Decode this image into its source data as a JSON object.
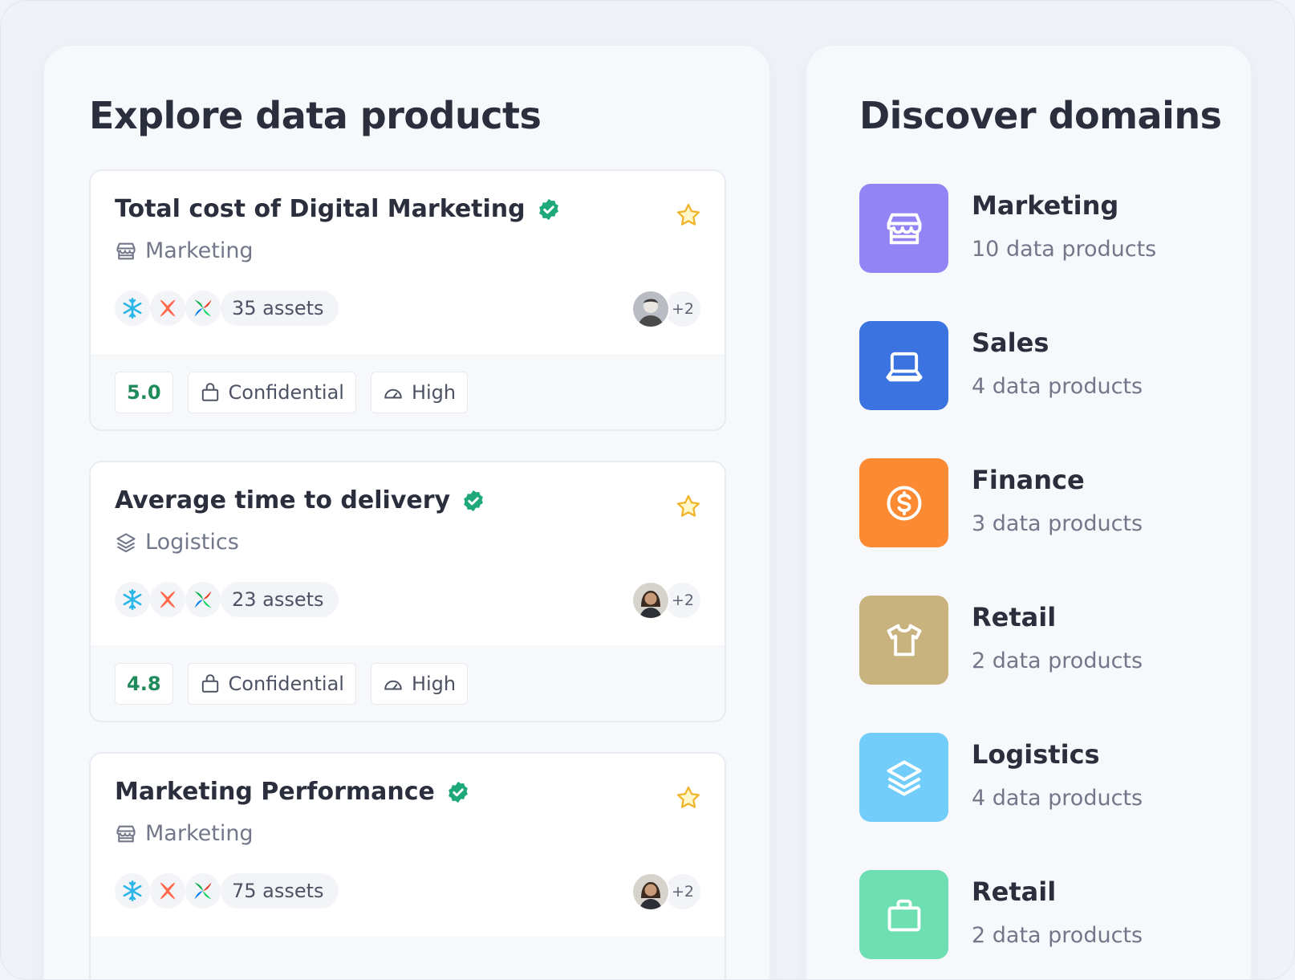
{
  "products_panel": {
    "title": "Explore data products",
    "cards": [
      {
        "title": "Total cost of Digital Marketing",
        "domain": "Marketing",
        "assets": "35 assets",
        "owners_more": "+2",
        "score": "5.0",
        "confidentiality": "Confidential",
        "criticality": "High"
      },
      {
        "title": "Average time to delivery",
        "domain": "Logistics",
        "assets": "23 assets",
        "owners_more": "+2",
        "score": "4.8",
        "confidentiality": "Confidential",
        "criticality": "High"
      },
      {
        "title": "Marketing Performance",
        "domain": "Marketing",
        "assets": "75 assets",
        "owners_more": "+2",
        "score": "",
        "confidentiality": "",
        "criticality": ""
      }
    ]
  },
  "domains_panel": {
    "title": "Discover domains",
    "items": [
      {
        "name": "Marketing",
        "count": "10 data products",
        "color": "#9384f6",
        "icon": "store-icon"
      },
      {
        "name": "Sales",
        "count": "4 data products",
        "color": "#3b73e0",
        "icon": "laptop-icon"
      },
      {
        "name": "Finance",
        "count": "3 data products",
        "color": "#fb8a32",
        "icon": "dollar-icon"
      },
      {
        "name": "Retail",
        "count": "2 data products",
        "color": "#c8b27e",
        "icon": "shirt-icon"
      },
      {
        "name": "Logistics",
        "count": "4 data products",
        "color": "#72cdfb",
        "icon": "layers-icon"
      },
      {
        "name": "Retail",
        "count": "2 data products",
        "color": "#6ddfb2",
        "icon": "bag-icon"
      }
    ]
  }
}
